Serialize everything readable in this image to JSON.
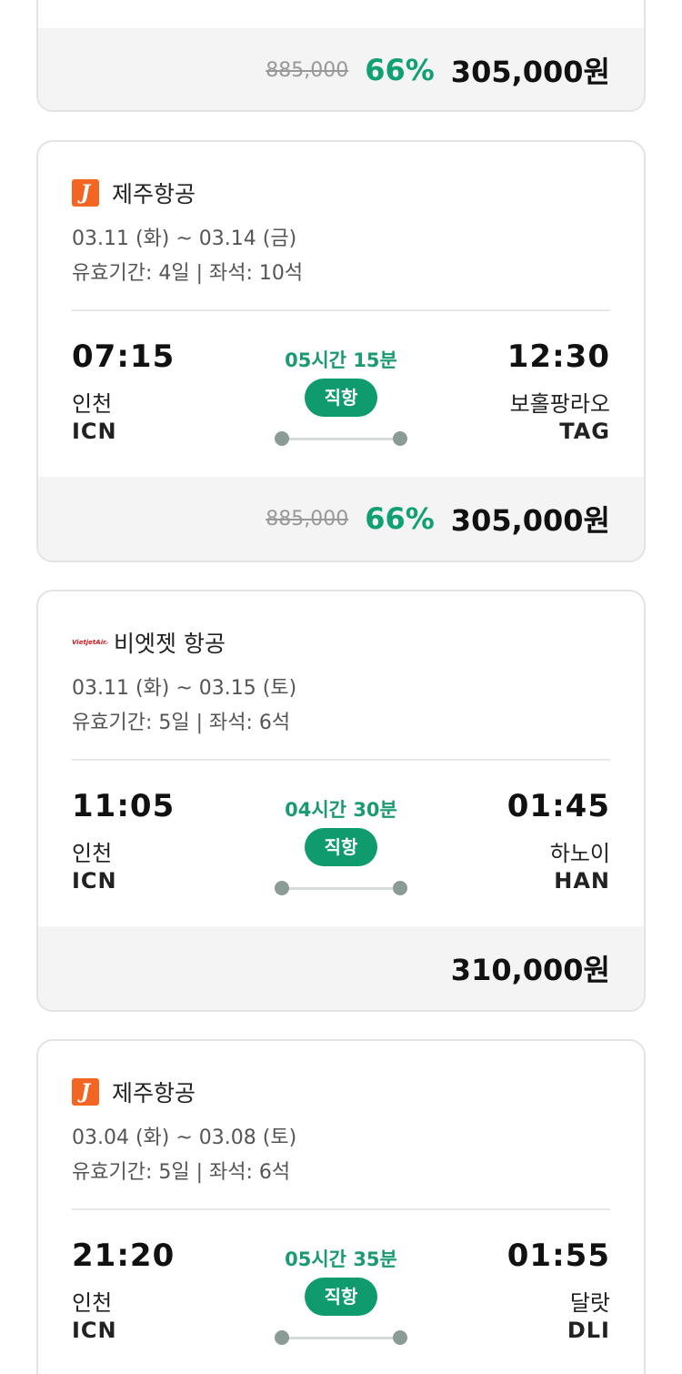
{
  "cards": [
    {
      "price": {
        "original": "885,000",
        "discount": "66%",
        "final": "305,000원"
      }
    },
    {
      "airline": {
        "name": "제주항공",
        "logo_icon": "jeju-air-logo-icon",
        "logo_text": "J"
      },
      "dates": "03.11 (화) ~ 03.14 (금)",
      "validity": "유효기간: 4일 | 좌석: 10석",
      "departure": {
        "time": "07:15",
        "city": "인천",
        "code": "ICN"
      },
      "arrival": {
        "time": "12:30",
        "city": "보홀팡라오",
        "code": "TAG"
      },
      "duration": "05시간 15분",
      "type": "직항",
      "price": {
        "original": "885,000",
        "discount": "66%",
        "final": "305,000원"
      }
    },
    {
      "airline": {
        "name": "비엣젯 항공",
        "logo_icon": "vietjet-logo-icon",
        "logo_text": "VietjetAir.com"
      },
      "dates": "03.11 (화) ~ 03.15 (토)",
      "validity": "유효기간: 5일 | 좌석: 6석",
      "departure": {
        "time": "11:05",
        "city": "인천",
        "code": "ICN"
      },
      "arrival": {
        "time": "01:45",
        "city": "하노이",
        "code": "HAN"
      },
      "duration": "04시간 30분",
      "type": "직항",
      "price": {
        "final": "310,000원"
      }
    },
    {
      "airline": {
        "name": "제주항공",
        "logo_icon": "jeju-air-logo-icon",
        "logo_text": "J"
      },
      "dates": "03.04 (화) ~ 03.08 (토)",
      "validity": "유효기간: 5일 | 좌석: 6석",
      "departure": {
        "time": "21:20",
        "city": "인천",
        "code": "ICN"
      },
      "arrival": {
        "time": "01:55",
        "city": "달랏",
        "code": "DLI"
      },
      "duration": "05시간 35분",
      "type": "직항"
    }
  ],
  "colors": {
    "accent_green": "#11a074",
    "badge_green": "#0f9b6e",
    "jeju_orange": "#f26522",
    "vietjet_red": "#d71920"
  }
}
